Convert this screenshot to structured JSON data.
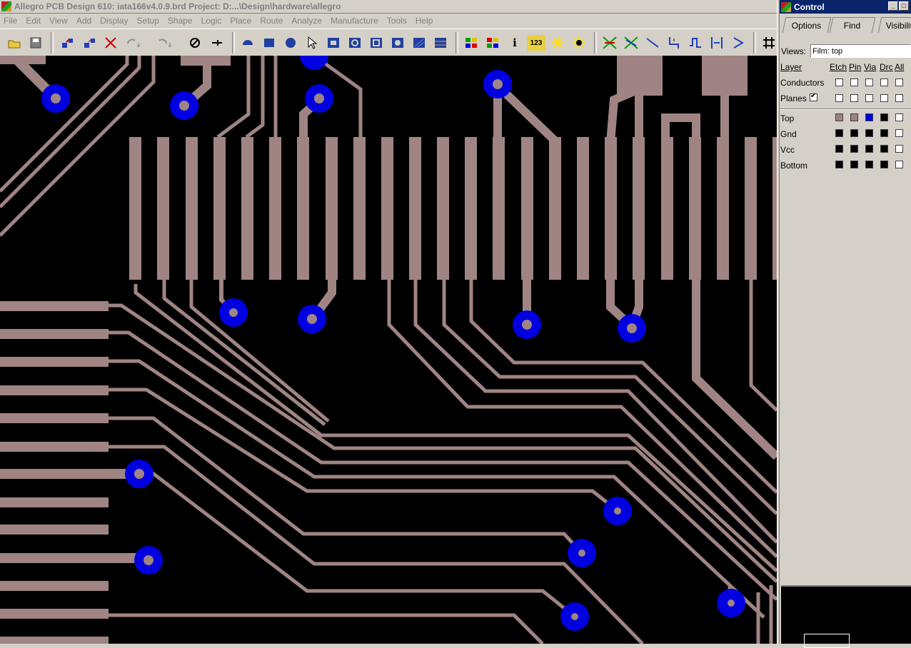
{
  "window": {
    "title": "Allegro PCB Design 610: iata166v4.0.9.brd  Project: D:...\\Design\\hardware\\allegro"
  },
  "menu": [
    "File",
    "Edit",
    "View",
    "Add",
    "Display",
    "Setup",
    "Shape",
    "Logic",
    "Place",
    "Route",
    "Analyze",
    "Manufacture",
    "Tools",
    "Help"
  ],
  "toolbar": {
    "tools": [
      "open-icon",
      "save-icon",
      "move-icon",
      "copy-icon",
      "delete-icon",
      "undo-icon",
      "redo-icon",
      "fix-icon",
      "pin-icon",
      "arc-icon",
      "rect-icon",
      "circle-icon",
      "select-icon",
      "shape-icon",
      "rotate-icon",
      "frame-icon",
      "round-icon",
      "hatch-icon",
      "grid-block-icon",
      "color-icon",
      "assign-color-icon",
      "info-icon",
      "measure-icon",
      "highlight-icon",
      "dehighlight-icon",
      "ratsnest-icon",
      "unratsnest-icon",
      "route-icon",
      "slide-icon",
      "delay-tune-icon",
      "spread-icon",
      "fanout-icon",
      "grid-icon"
    ],
    "info_glyph": "i",
    "measure_glyph": "123"
  },
  "control_panel": {
    "title": "Control",
    "tabs": [
      "Options",
      "Find",
      "Visibility"
    ],
    "views_label": "Views:",
    "views_value": "Film: top",
    "columns": [
      "Layer",
      "Etch",
      "Pin",
      "Via",
      "Drc",
      "All"
    ],
    "groups": [
      {
        "name": "Conductors",
        "etch": false,
        "pin": false,
        "via": false,
        "drc": false,
        "all": false
      },
      {
        "name": "Planes",
        "checked": true,
        "etch": false,
        "pin": false,
        "via": false,
        "drc": false,
        "all": false
      }
    ],
    "layers": [
      {
        "name": "Top",
        "colors": [
          "#a08080",
          "#a08080",
          "#0000e0",
          "#000000"
        ],
        "all": false
      },
      {
        "name": "Gnd",
        "colors": [
          "#000000",
          "#000000",
          "#000000",
          "#000000"
        ],
        "all": false
      },
      {
        "name": "Vcc",
        "colors": [
          "#000000",
          "#000000",
          "#000000",
          "#000000"
        ],
        "all": false
      },
      {
        "name": "Bottom",
        "colors": [
          "#000000",
          "#000000",
          "#000000",
          "#000000"
        ],
        "all": false
      }
    ]
  },
  "colors": {
    "etch": "#a08484",
    "via": "#0000e0",
    "background": "#000000",
    "titlebar_active": "#0a246a"
  }
}
